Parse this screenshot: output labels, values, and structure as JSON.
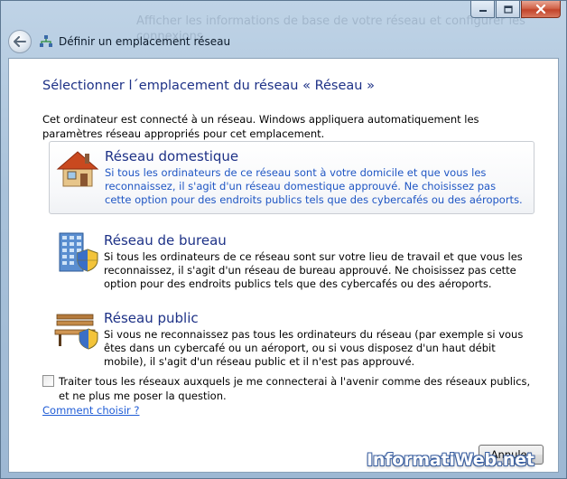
{
  "window": {
    "title": "Définir un emplacement réseau",
    "background_ghost_text": "Afficher les informations de base de votre réseau et configurer les connexions"
  },
  "main": {
    "heading": "Sélectionner l´emplacement du réseau « Réseau »",
    "intro": "Cet ordinateur est connecté à un réseau. Windows appliquera automatiquement les paramètres réseau appropriés pour cet emplacement.",
    "options": [
      {
        "title": "Réseau domestique",
        "description": "Si tous les ordinateurs de ce réseau sont à votre domicile et que vous les reconnaissez, il s'agit d'un réseau domestique approuvé. Ne choisissez pas cette option pour des endroits publics tels que des cybercafés ou des aéroports.",
        "icon": "house-icon"
      },
      {
        "title": "Réseau de bureau",
        "description": "Si tous les ordinateurs de ce réseau sont sur votre lieu de travail et que vous les reconnaissez, il s'agit d'un réseau de bureau approuvé. Ne choisissez pas cette option pour des endroits publics tels que des cybercafés ou des aéroports.",
        "icon": "office-building-shield-icon"
      },
      {
        "title": "Réseau public",
        "description": "Si vous ne reconnaissez pas tous les ordinateurs du réseau (par exemple si vous êtes dans un cybercafé ou un aéroport, ou si vous disposez d'un haut débit mobile), il s'agit d'un réseau public et il n'est pas approuvé.",
        "icon": "park-bench-shield-icon"
      }
    ],
    "checkbox_label": "Traiter tous les réseaux auxquels je me connecterai à l'avenir comme des réseaux publics, et ne plus me poser la question.",
    "checkbox_checked": false,
    "help_link": "Comment choisir ?"
  },
  "footer": {
    "cancel_label": "Annuler",
    "watermark": "InformatiWeb.net"
  },
  "colors": {
    "heading": "#1e3287",
    "link": "#1f5cd6",
    "highlight_text": "#1f56c4"
  }
}
